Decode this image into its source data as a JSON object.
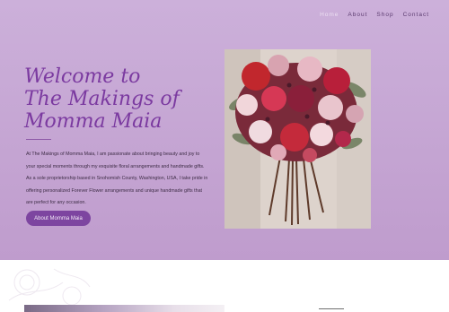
{
  "nav": {
    "items": [
      {
        "label": "Home",
        "active": true
      },
      {
        "label": "About",
        "active": false
      },
      {
        "label": "Shop",
        "active": false
      },
      {
        "label": "Contact",
        "active": false
      }
    ]
  },
  "hero": {
    "title_lines": [
      "Welcome to",
      "The Makings of",
      "Momma Maia"
    ],
    "paragraph": "At The Makings of Momma Maia, I am passionate about bringing beauty and joy to your special moments through my exquisite floral arrangements and handmade gifts. As a sole proprietorship based in Snohomish County, Washington, USA, I take pride in offering personalized Forever Flower arrangements and unique handmade gifts that are perfect for any occasion.",
    "button_label": "About Momma Maia",
    "image": "bouquet-photo"
  },
  "colors": {
    "hero_background": "#c6a7d4",
    "title": "#7b3aa0",
    "button": "#7d45a0",
    "nav_active": "#ece0f2"
  },
  "lower_section": {
    "image": "floral-photo",
    "decoration": "line-art-flowers"
  }
}
